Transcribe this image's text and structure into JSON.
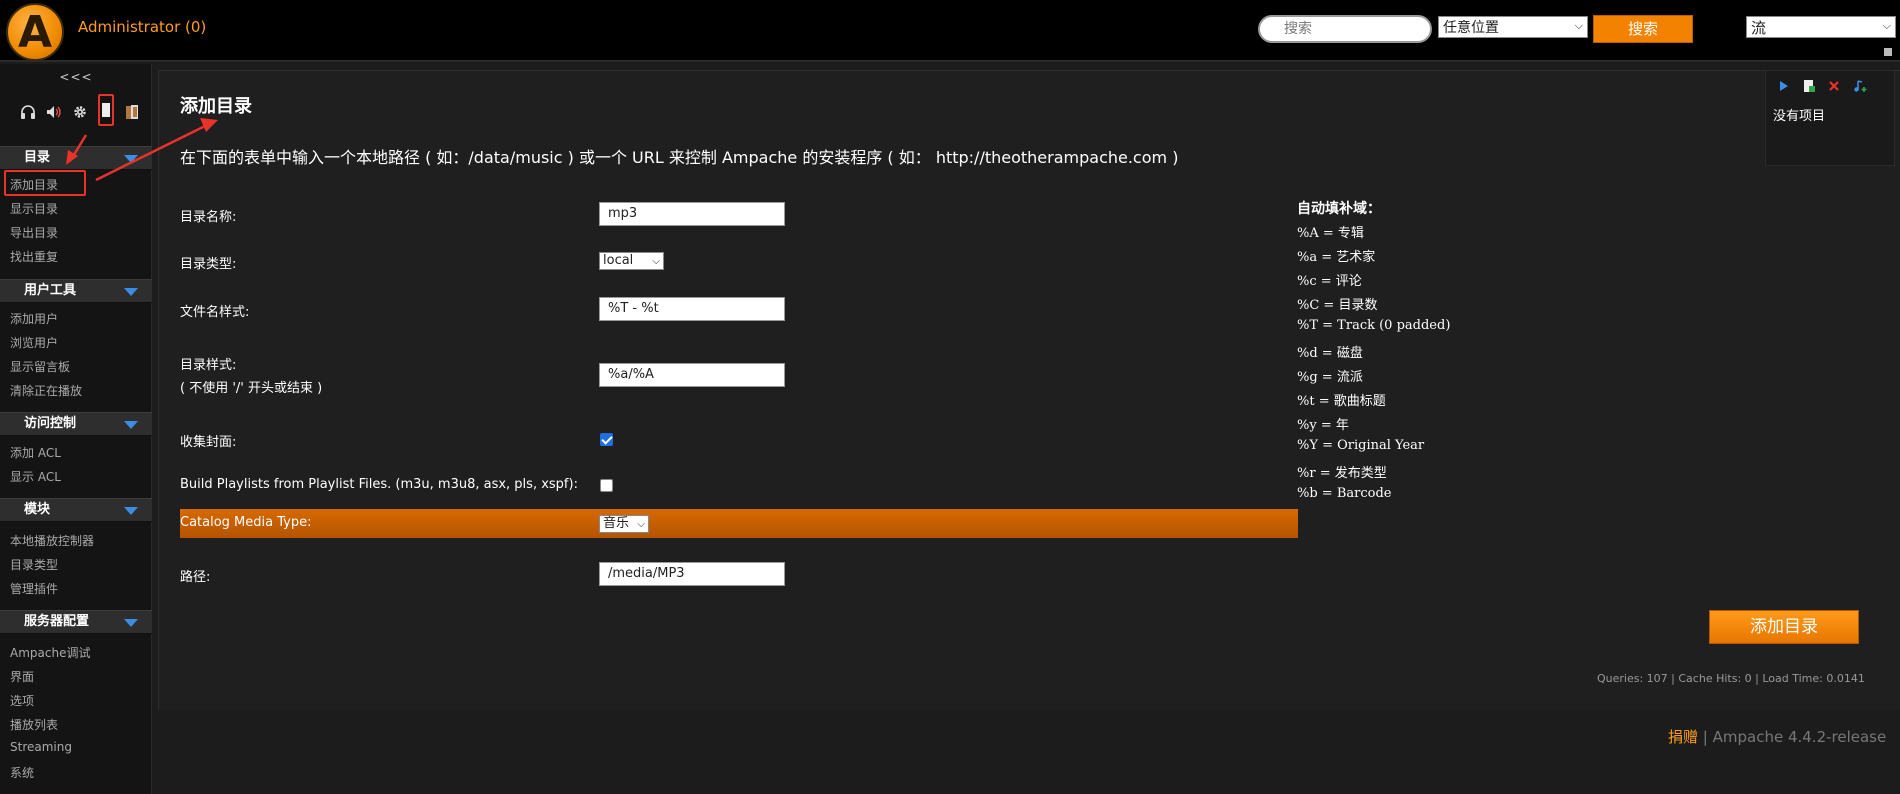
{
  "header": {
    "logo_letter": "A",
    "user": "Administrator (0)",
    "search_placeholder": "搜索",
    "search_scope": "任意位置",
    "search_button": "搜索",
    "stream_select": "流"
  },
  "sidebar": {
    "collapse": "<<<",
    "sections": [
      {
        "title": "目录",
        "items": [
          "添加目录",
          "显示目录",
          "导出目录",
          "找出重复"
        ]
      },
      {
        "title": "用户工具",
        "items": [
          "添加用户",
          "浏览用户",
          "显示留言板",
          "清除正在播放"
        ]
      },
      {
        "title": "访问控制",
        "items": [
          "添加 ACL",
          "显示 ACL"
        ]
      },
      {
        "title": "模块",
        "items": [
          "本地播放控制器",
          "目录类型",
          "管理插件"
        ]
      },
      {
        "title": "服务器配置",
        "items": [
          "Ampache调试",
          "界面",
          "选项",
          "播放列表",
          "Streaming",
          "系统"
        ]
      }
    ]
  },
  "main": {
    "title": "添加目录",
    "description": "在下面的表单中输入一个本地路径 ( 如：/data/music ) 或一个 URL 来控制 Ampache 的安装程序 ( 如： http://theotherampache.com )",
    "form": {
      "catalog_name_label": "目录名称:",
      "catalog_name_value": "mp3",
      "catalog_type_label": "目录类型:",
      "catalog_type_value": "local",
      "filename_pattern_label": "文件名样式:",
      "filename_pattern_value": "%T - %t",
      "folder_pattern_label": "目录样式:",
      "folder_pattern_hint": "( 不使用 '/' 开头或结束 )",
      "folder_pattern_value": "%a/%A",
      "gather_art_label": "收集封面:",
      "gather_art_checked": true,
      "build_playlists_label": "Build Playlists from Playlist Files. (m3u, m3u8, asx, pls, xspf):",
      "build_playlists_checked": false,
      "media_type_label": "Catalog Media Type:",
      "media_type_value": "音乐",
      "path_label": "路径:",
      "path_value": "/media/MP3"
    },
    "auto_fill": {
      "title": "自动填补域：",
      "items": [
        "%A = 专辑",
        "%a = 艺术家",
        "%c = 评论",
        "%C = 目录数",
        "%T = Track (0 padded)",
        "%d = 磁盘",
        "%g = 流派",
        "%t = 歌曲标题",
        "%y = 年",
        "%Y = Original Year",
        "%r = 发布类型",
        "%b = Barcode"
      ]
    },
    "submit_button": "添加目录",
    "stats": "Queries: 107 | Cache Hits: 0 | Load Time: 0.0141"
  },
  "right_box": {
    "no_items": "没有项目"
  },
  "footer": {
    "donate": "捐赠",
    "separator": " | ",
    "version": "Ampache 4.4.2-release"
  },
  "colors": {
    "accent": "#f38200",
    "highlight_row": "#c85f00",
    "annotation_red": "#e8322a",
    "triangle_blue": "#3a8ee6"
  }
}
